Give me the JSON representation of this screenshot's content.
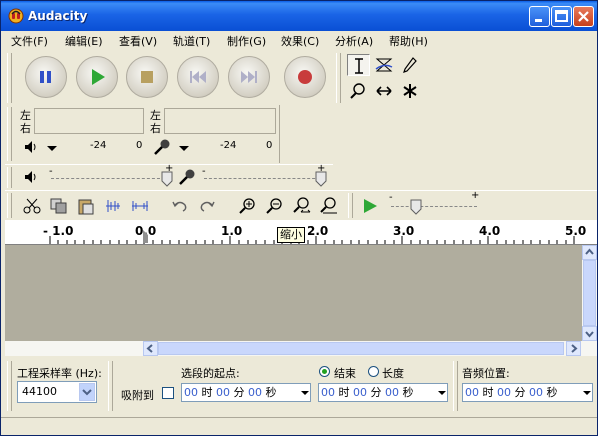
{
  "window": {
    "title": "Audacity"
  },
  "menu": [
    "文件(F)",
    "编辑(E)",
    "查看(V)",
    "轨道(T)",
    "制作(G)",
    "效果(C)",
    "分析(A)",
    "帮助(H)"
  ],
  "meters": {
    "left": "左",
    "right": "右",
    "ticks_output": [
      "-24",
      "0"
    ],
    "ticks_input": [
      "-24",
      "0"
    ]
  },
  "mixer": {
    "minus": "-",
    "plus": "+"
  },
  "ruler": {
    "labels": [
      "- 1.0",
      "0.0",
      "1.0",
      "2.0",
      "3.0",
      "4.0",
      "5.0"
    ]
  },
  "tooltip": "缩小",
  "selection": {
    "project_rate_label": "工程采样率 (Hz):",
    "project_rate": "44100",
    "snap_label": "吸附到",
    "start_label": "选段的起点:",
    "end_label": "结束",
    "length_label": "长度",
    "audio_pos_label": "音频位置:",
    "time": {
      "h": "00",
      "h_unit": "时",
      "m": "00",
      "m_unit": "分",
      "s": "00",
      "s_unit": "秒"
    }
  },
  "colors": {
    "titlebar": "#0a5ee8",
    "track_bg": "#b0ad9e",
    "play_green": "#2ea836",
    "record_red": "#c83c3c",
    "pause_blue": "#3050c8"
  }
}
